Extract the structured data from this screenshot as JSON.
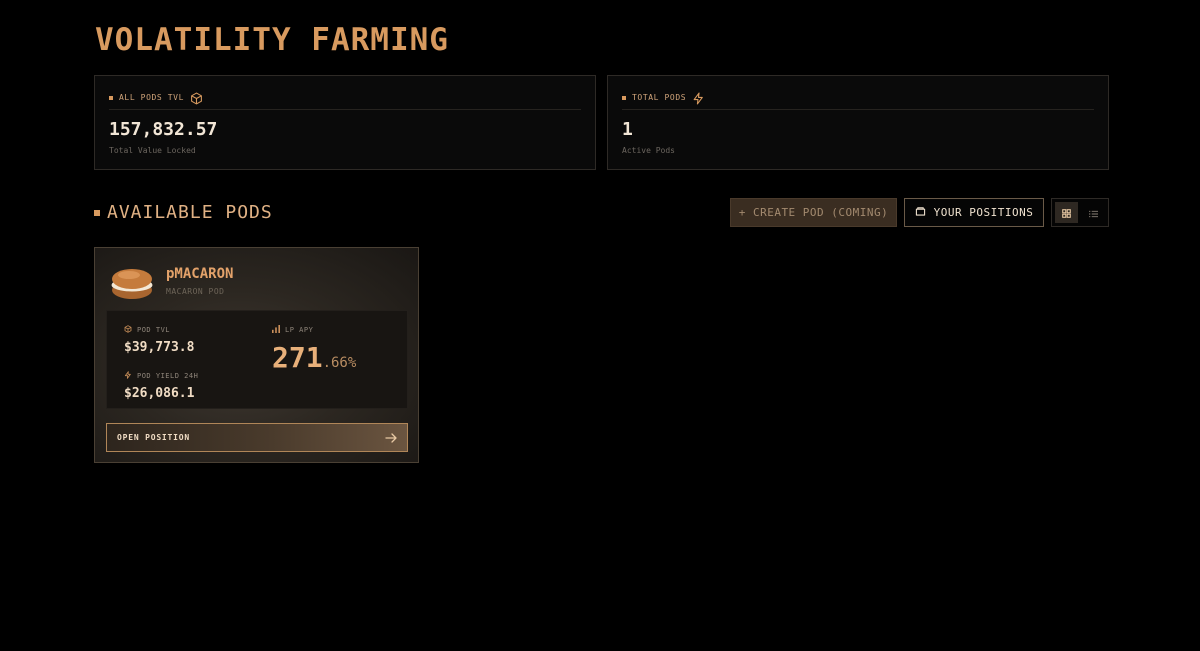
{
  "page": {
    "title": "VOLATILITY FARMING"
  },
  "stats": [
    {
      "label": "ALL PODS TVL",
      "value": "157,832.57",
      "subtitle": "Total Value Locked",
      "icon": "cube-icon"
    },
    {
      "label": "TOTAL PODS",
      "value": "1",
      "subtitle": "Active Pods",
      "icon": "lightning-icon"
    }
  ],
  "section": {
    "title": "AVAILABLE PODS",
    "create_button": "+ CREATE POD (COMING)",
    "positions_button": "YOUR POSITIONS",
    "view_modes": [
      "grid",
      "list"
    ],
    "active_view": "grid"
  },
  "pods": [
    {
      "name": "pMACARON",
      "subtitle": "MACARON POD",
      "avatar": "macaron-image",
      "tvl_label": "POD TVL",
      "tvl_value": "$39,773.8",
      "yield_label": "POD YIELD 24H",
      "yield_value": "$26,086.1",
      "apy_label": "LP APY",
      "apy_int": "271",
      "apy_dec": ".66%",
      "action_label": "OPEN POSITION"
    }
  ],
  "colors": {
    "background": "#000000",
    "accent": "#d89a5f",
    "card_border": "#2e2a26",
    "button_disabled": "#3a2d21"
  }
}
